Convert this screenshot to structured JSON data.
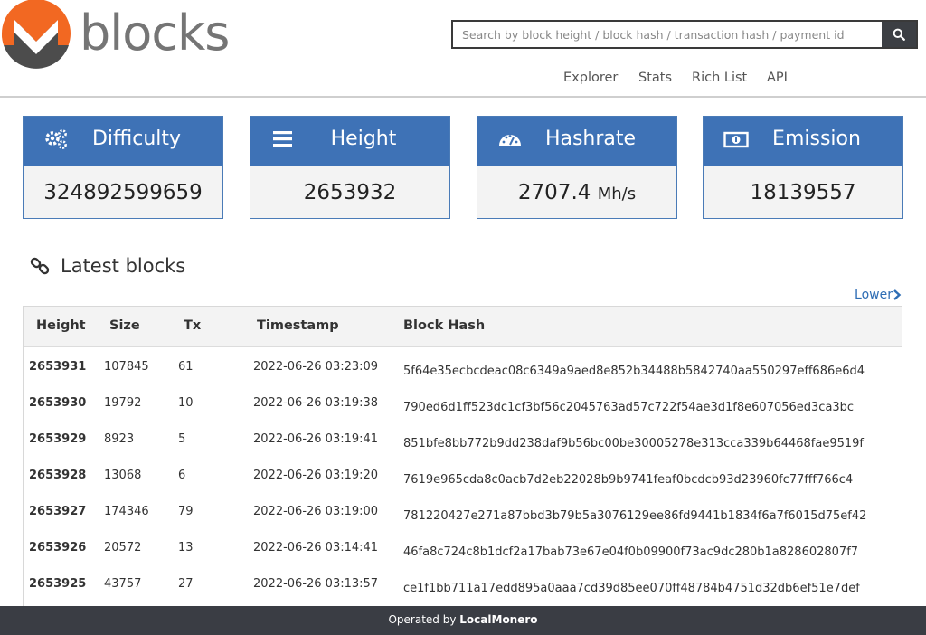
{
  "header": {
    "logo_text": "blocks",
    "search_placeholder": "Search by block height / block hash / transaction hash / payment id",
    "nav": [
      "Explorer",
      "Stats",
      "Rich List",
      "API"
    ]
  },
  "stats": [
    {
      "title": "Difficulty",
      "value": "324892599659",
      "unit": "",
      "icon": "gears-icon"
    },
    {
      "title": "Height",
      "value": "2653932",
      "unit": "",
      "icon": "list-icon"
    },
    {
      "title": "Hashrate",
      "value": "2707.4",
      "unit": "Mh/s",
      "icon": "speedometer-icon"
    },
    {
      "title": "Emission",
      "value": "18139557",
      "unit": "",
      "icon": "banknote-icon"
    }
  ],
  "latest": {
    "title": "Latest blocks",
    "lower_label": "Lower",
    "columns": [
      "Height",
      "Size",
      "Tx",
      "Timestamp",
      "Block Hash"
    ],
    "rows": [
      {
        "height": "2653931",
        "size": "107845",
        "tx": "61",
        "timestamp": "2022-06-26 03:23:09",
        "hash": "5f64e35ecbcdeac08c6349a9aed8e852b34488b5842740aa550297eff686e6d4"
      },
      {
        "height": "2653930",
        "size": "19792",
        "tx": "10",
        "timestamp": "2022-06-26 03:19:38",
        "hash": "790ed6d1ff523dc1cf3bf56c2045763ad57c722f54ae3d1f8e607056ed3ca3bc"
      },
      {
        "height": "2653929",
        "size": "8923",
        "tx": "5",
        "timestamp": "2022-06-26 03:19:41",
        "hash": "851bfe8bb772b9dd238daf9b56bc00be30005278e313cca339b64468fae9519f"
      },
      {
        "height": "2653928",
        "size": "13068",
        "tx": "6",
        "timestamp": "2022-06-26 03:19:20",
        "hash": "7619e965cda8c0acb7d2eb22028b9b9741feaf0bcdcb93d23960fc77fff766c4"
      },
      {
        "height": "2653927",
        "size": "174346",
        "tx": "79",
        "timestamp": "2022-06-26 03:19:00",
        "hash": "781220427e271a87bbd3b79b5a3076129ee86fd9441b1834f6a7f6015d75ef42"
      },
      {
        "height": "2653926",
        "size": "20572",
        "tx": "13",
        "timestamp": "2022-06-26 03:14:41",
        "hash": "46fa8c724c8b1dcf2a17bab73e67e04f0b09900f73ac9dc280b1a828602807f7"
      },
      {
        "height": "2653925",
        "size": "43757",
        "tx": "27",
        "timestamp": "2022-06-26 03:13:57",
        "hash": "ce1f1bb711a17edd895a0aaa7cd39d85ee070ff48784b4751d32db6ef51e7def"
      }
    ]
  },
  "footer": {
    "prefix": "Operated by",
    "brand": "LocalMonero"
  },
  "colors": {
    "accent": "#3e72b6",
    "monero_orange": "#f26822",
    "footer_bg": "#3a3d44"
  }
}
